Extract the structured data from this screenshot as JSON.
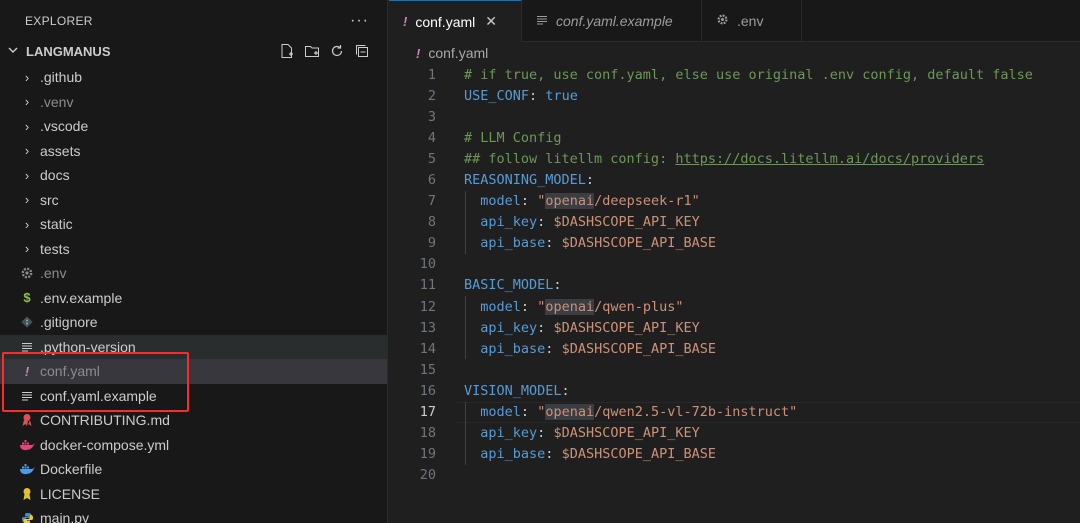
{
  "sidebar": {
    "title": "EXPLORER",
    "more": "···",
    "folder": "LANGMANUS",
    "items": [
      {
        "label": ".github",
        "icon": "chevron-right-icon"
      },
      {
        "label": ".venv",
        "icon": "chevron-right-icon"
      },
      {
        "label": ".vscode",
        "icon": "chevron-right-icon"
      },
      {
        "label": "assets",
        "icon": "chevron-right-icon"
      },
      {
        "label": "docs",
        "icon": "chevron-right-icon"
      },
      {
        "label": "src",
        "icon": "chevron-right-icon"
      },
      {
        "label": "static",
        "icon": "chevron-right-icon"
      },
      {
        "label": "tests",
        "icon": "chevron-right-icon"
      },
      {
        "label": ".env",
        "icon": "gear-icon"
      },
      {
        "label": ".env.example",
        "icon": "dollar-icon"
      },
      {
        "label": ".gitignore",
        "icon": "git-icon"
      },
      {
        "label": ".python-version",
        "icon": "lines-icon"
      },
      {
        "label": "conf.yaml",
        "icon": "exclamation-icon"
      },
      {
        "label": "conf.yaml.example",
        "icon": "lines-icon"
      },
      {
        "label": "CONTRIBUTING.md",
        "icon": "ribbon-icon"
      },
      {
        "label": "docker-compose.yml",
        "icon": "docker-icon"
      },
      {
        "label": "Dockerfile",
        "icon": "docker-icon"
      },
      {
        "label": "LICENSE",
        "icon": "license-icon"
      },
      {
        "label": "main.py",
        "icon": "python-icon"
      }
    ]
  },
  "tabs": [
    {
      "label": "conf.yaml",
      "icon": "exclamation-icon",
      "close": "✕"
    },
    {
      "label": "conf.yaml.example",
      "icon": "lines-icon"
    },
    {
      "label": ".env",
      "icon": "gear-icon"
    }
  ],
  "breadcrumb": "conf.yaml",
  "colors": {
    "accent": "#0078d4",
    "highlight_box": "#ff2a2a",
    "comment": "#6a9955",
    "key": "#569cd6",
    "string": "#ce9178"
  },
  "editor": {
    "current_line": 17,
    "lines": [
      {
        "n": "1",
        "c": "# if true, use conf.yaml, else use original .env config, default false"
      },
      {
        "n": "2",
        "k": "USE_CONF",
        "v": "true"
      },
      {
        "n": "3"
      },
      {
        "n": "4",
        "c": "# LLM Config"
      },
      {
        "n": "5",
        "c": "## follow litellm config: ",
        "u": "https://docs.litellm.ai/docs/providers"
      },
      {
        "n": "6",
        "k": "REASONING_MODEL"
      },
      {
        "n": "7",
        "k": "model",
        "q1": "openai",
        "q2": "/deepseek-r1"
      },
      {
        "n": "8",
        "k": "api_key",
        "v": "$DASHSCOPE_API_KEY"
      },
      {
        "n": "9",
        "k": "api_base",
        "v": "$DASHSCOPE_API_BASE"
      },
      {
        "n": "10"
      },
      {
        "n": "11",
        "k": "BASIC_MODEL"
      },
      {
        "n": "12",
        "k": "model",
        "q1": "openai",
        "q2": "/qwen-plus"
      },
      {
        "n": "13",
        "k": "api_key",
        "v": "$DASHSCOPE_API_KEY"
      },
      {
        "n": "14",
        "k": "api_base",
        "v": "$DASHSCOPE_API_BASE"
      },
      {
        "n": "15"
      },
      {
        "n": "16",
        "k": "VISION_MODEL"
      },
      {
        "n": "17",
        "k": "model",
        "q1": "openai",
        "q2": "/qwen2.5-vl-72b-instruct"
      },
      {
        "n": "18",
        "k": "api_key",
        "v": "$DASHSCOPE_API_KEY"
      },
      {
        "n": "19",
        "k": "api_base",
        "v": "$DASHSCOPE_API_BASE"
      },
      {
        "n": "20"
      }
    ]
  }
}
